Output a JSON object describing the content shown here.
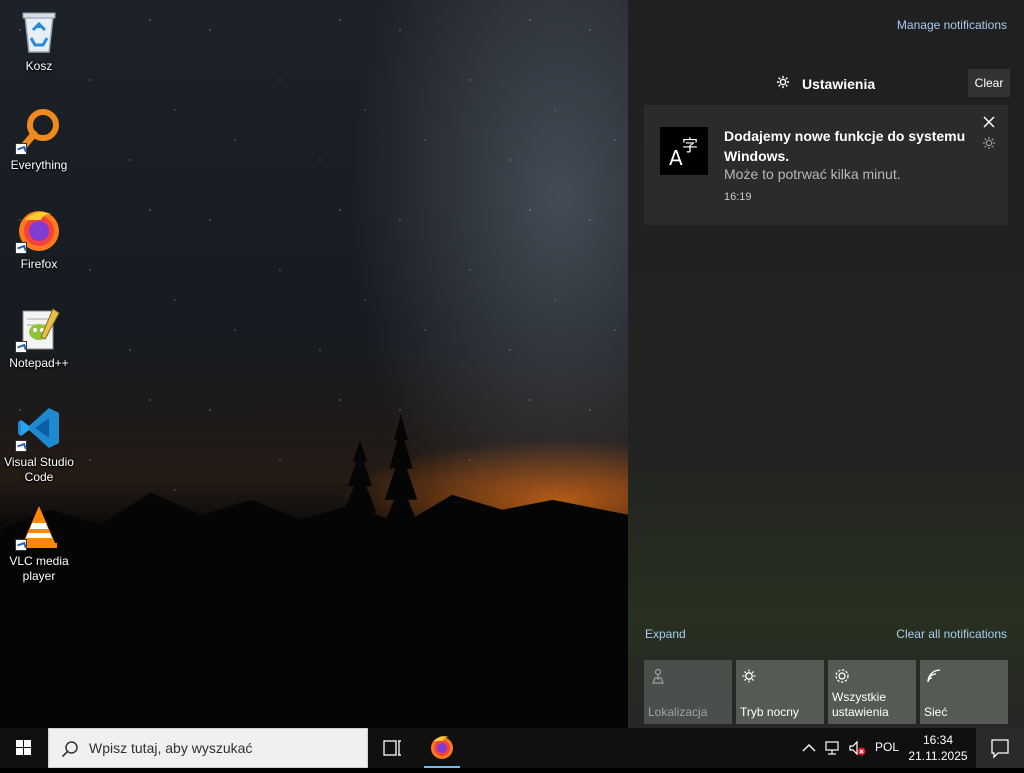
{
  "desktop": {
    "icons": [
      {
        "label": "Kosz",
        "icon": "recycle-bin-icon",
        "shortcut": false
      },
      {
        "label": "Everything",
        "icon": "everything-search-icon",
        "shortcut": true
      },
      {
        "label": "Firefox",
        "icon": "firefox-icon",
        "shortcut": true
      },
      {
        "label": "Notepad++",
        "icon": "notepadpp-icon",
        "shortcut": true
      },
      {
        "label": "Visual Studio Code",
        "icon": "vscode-icon",
        "shortcut": true
      },
      {
        "label": "VLC media player",
        "icon": "vlc-icon",
        "shortcut": true
      }
    ]
  },
  "action_center": {
    "manage_label": "Manage notifications",
    "group": {
      "icon": "gear-icon",
      "title": "Ustawienia",
      "clear_label": "Clear"
    },
    "notification": {
      "icon": "language-icon",
      "title": "Dodajemy nowe funkcje do systemu Windows.",
      "body": "Może to potrwać kilka minut.",
      "time": "16:19"
    },
    "expand_label": "Expand",
    "clear_all_label": "Clear all notifications",
    "quick_actions": [
      {
        "label": "Lokalizacja",
        "icon": "location-icon",
        "enabled": false
      },
      {
        "label": "Tryb nocny",
        "icon": "night-light-icon",
        "enabled": true
      },
      {
        "label": "Wszystkie ustawienia",
        "icon": "settings-icon",
        "enabled": true
      },
      {
        "label": "Sieć",
        "icon": "network-icon",
        "enabled": true
      }
    ]
  },
  "taskbar": {
    "search_placeholder": "Wpisz tutaj, aby wyszukać",
    "language": "POL",
    "time": "16:34",
    "date": "21.11.2025"
  },
  "colors": {
    "accent_link": "#a6cdf0",
    "taskbar_bg": "#101010",
    "panel_bg": "#202020",
    "tile_bg": "#555a55"
  }
}
